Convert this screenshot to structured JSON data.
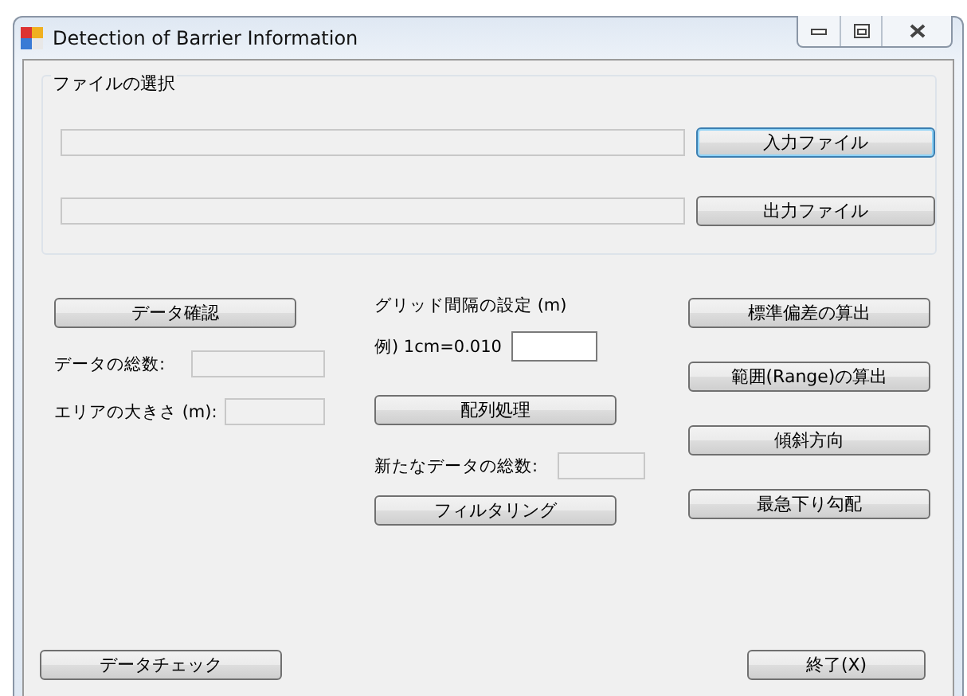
{
  "window": {
    "title": "Detection of Barrier Information"
  },
  "file_group": {
    "label": "ファイルの選択",
    "rows": [
      {
        "field": {
          "disabled": true
        },
        "button": {
          "label": "入力ファイル",
          "focused": true
        }
      },
      {
        "field": {
          "disabled": true
        },
        "button": {
          "label": "出力ファイル",
          "focused": false
        }
      }
    ]
  },
  "left": {
    "button": {
      "label": "データ確認",
      "focused": false
    },
    "rows": [
      {
        "label": "データの総数:",
        "field": {
          "disabled": true
        }
      },
      {
        "label": "エリアの大きさ (m):",
        "field": {
          "disabled": true
        }
      }
    ]
  },
  "middle": {
    "heading": "グリッド間隔の設定 (m)",
    "example": {
      "label": "例) 1cm=0.010",
      "field": {
        "disabled": false
      }
    },
    "array_button": {
      "label": "配列処理",
      "focused": false
    },
    "count": {
      "label": "新たなデータの総数:",
      "field": {
        "disabled": true
      }
    },
    "filter_button": {
      "label": "フィルタリング",
      "focused": false
    }
  },
  "right_buttons": [
    {
      "label": "標準偏差の算出",
      "focused": false
    },
    {
      "label": "範囲(Range)の算出",
      "focused": false
    },
    {
      "label": "傾斜方向",
      "focused": false
    },
    {
      "label": "最急下り勾配",
      "focused": false
    }
  ],
  "bottom": {
    "check_button": {
      "label": "データチェック",
      "focused": false
    },
    "exit_button": {
      "label": "終了(X)",
      "focused": false
    }
  }
}
